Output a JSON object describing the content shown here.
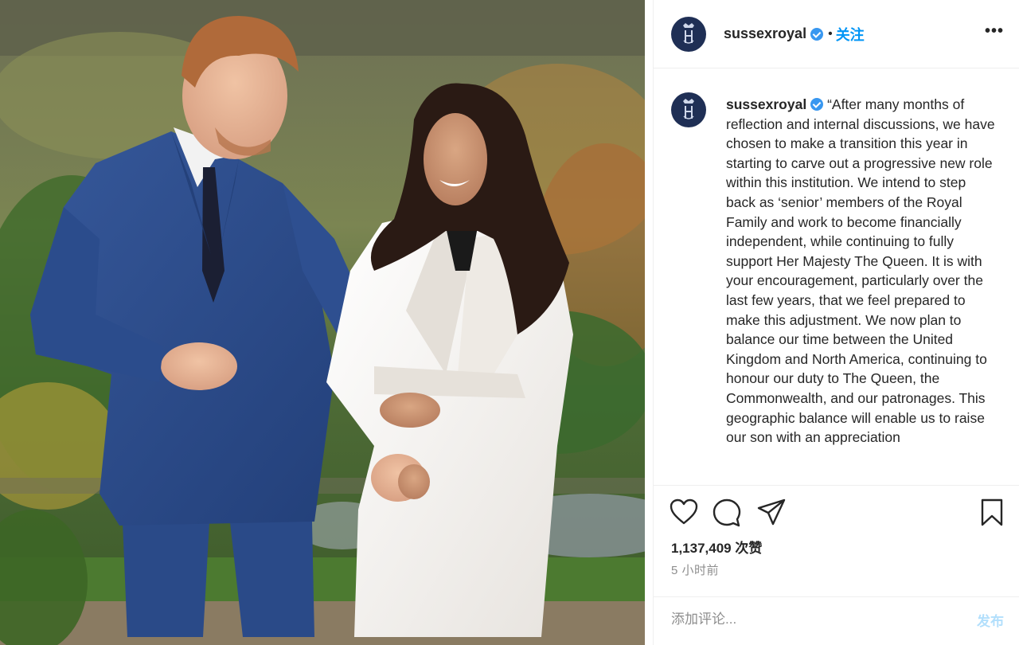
{
  "header": {
    "username": "sussexroyal",
    "separator": "•",
    "follow_label": "关注",
    "more_label": "•••"
  },
  "caption": {
    "username": "sussexroyal",
    "text": "“After many months of reflection and internal discussions, we have chosen to make a transition this year in starting to carve out a progressive new role within this institution. We intend to step back as ‘senior’ members of the Royal Family and work to become financially independent, while continuing to fully support Her Majesty The Queen. It is with your encouragement, particularly over the last few years, that we feel prepared to make this adjustment. We now plan to balance our time between the United Kingdom and North America, continuing to honour our duty to The Queen, the Commonwealth, and our patronages. This geographic balance will enable us to raise our son with an appreciation"
  },
  "actions": {
    "like_icon": "heart-icon",
    "comment_icon": "comment-icon",
    "share_icon": "share-icon",
    "save_icon": "bookmark-icon"
  },
  "stats": {
    "likes": "1,137,409 次赞",
    "time_ago": "5 小时前"
  },
  "comment_box": {
    "placeholder": "添加评论...",
    "post_label": "发布"
  },
  "colors": {
    "accent": "#0095f6",
    "verified": "#3897f0",
    "avatar_bg": "#1f2f55",
    "border": "#efefef",
    "muted": "#8e8e8e",
    "post_disabled": "#b2dffc"
  }
}
